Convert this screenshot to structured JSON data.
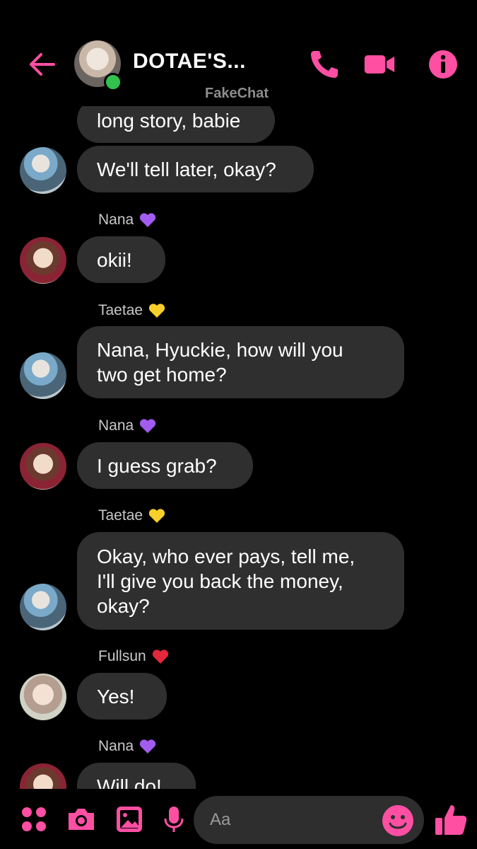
{
  "header": {
    "title": "DOTAE'S...",
    "watermark": "FakeChat"
  },
  "colors": {
    "accent": "#ff4fa3",
    "bubble": "#2f2f2f",
    "background": "#000000",
    "online": "#31c24d"
  },
  "messages": [
    {
      "sender": "",
      "text": "long story, babie"
    },
    {
      "sender": "",
      "text": "We'll tell later, okay?"
    },
    {
      "sender": "Nana",
      "heart": "purple-heart",
      "text": "okii!"
    },
    {
      "sender": "Taetae",
      "heart": "yellow-heart",
      "text_lines": [
        "Nana, Hyuckie,  how will you",
        "two get home?"
      ]
    },
    {
      "sender": "Nana",
      "heart": "purple-heart",
      "text": "I guess grab?"
    },
    {
      "sender": "Taetae",
      "heart": "yellow-heart",
      "text_lines": [
        "Okay,  who ever pays, tell me,",
        "I'll give you back the money,",
        "okay?"
      ]
    },
    {
      "sender": "Fullsun",
      "heart": "red-heart",
      "text": "Yes!"
    },
    {
      "sender": "Nana",
      "heart": "purple-heart",
      "text": "Will do!"
    }
  ],
  "composer": {
    "placeholder": "Aa"
  }
}
